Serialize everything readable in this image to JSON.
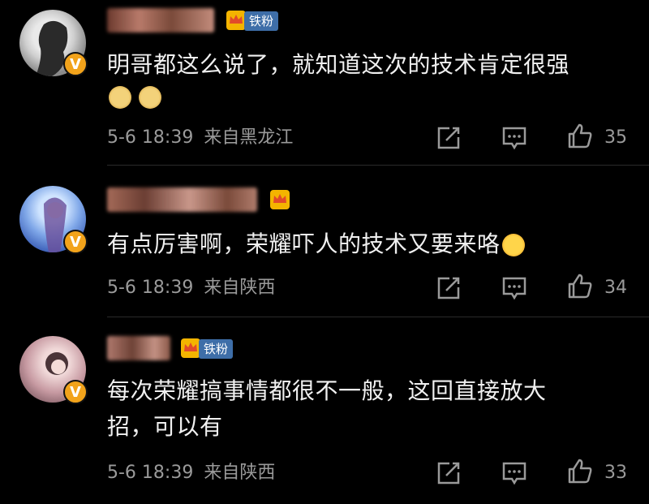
{
  "comments": [
    {
      "badge": "铁粉",
      "text_lines": [
        "明哥都这么说了，就知道这次的技术肯定很强"
      ],
      "emoji_count": 2,
      "time": "5-6 18:39",
      "location": "来自黑龙江",
      "likes": "35",
      "verified": "V"
    },
    {
      "badge": "",
      "text_lines": [
        "有点厉害啊，荣耀吓人的技术又要来咯"
      ],
      "emoji_count": 1,
      "time": "5-6 18:39",
      "location": "来自陕西",
      "likes": "34",
      "verified": "V"
    },
    {
      "badge": "铁粉",
      "text_lines": [
        "每次荣耀搞事情都很不一般，这回直接放大",
        "招，可以有"
      ],
      "emoji_count": 0,
      "time": "5-6 18:39",
      "location": "来自陕西",
      "likes": "33",
      "verified": "V"
    }
  ],
  "icons": {
    "share": "share-icon",
    "comment": "comment-icon",
    "like": "thumbs-up-icon",
    "crown": "crown-icon"
  },
  "colors": {
    "background": "#000000",
    "text": "#f0f0f0",
    "meta": "#9a9a9a",
    "badge": "#3e6ea8",
    "verify": "#f2a31b"
  }
}
